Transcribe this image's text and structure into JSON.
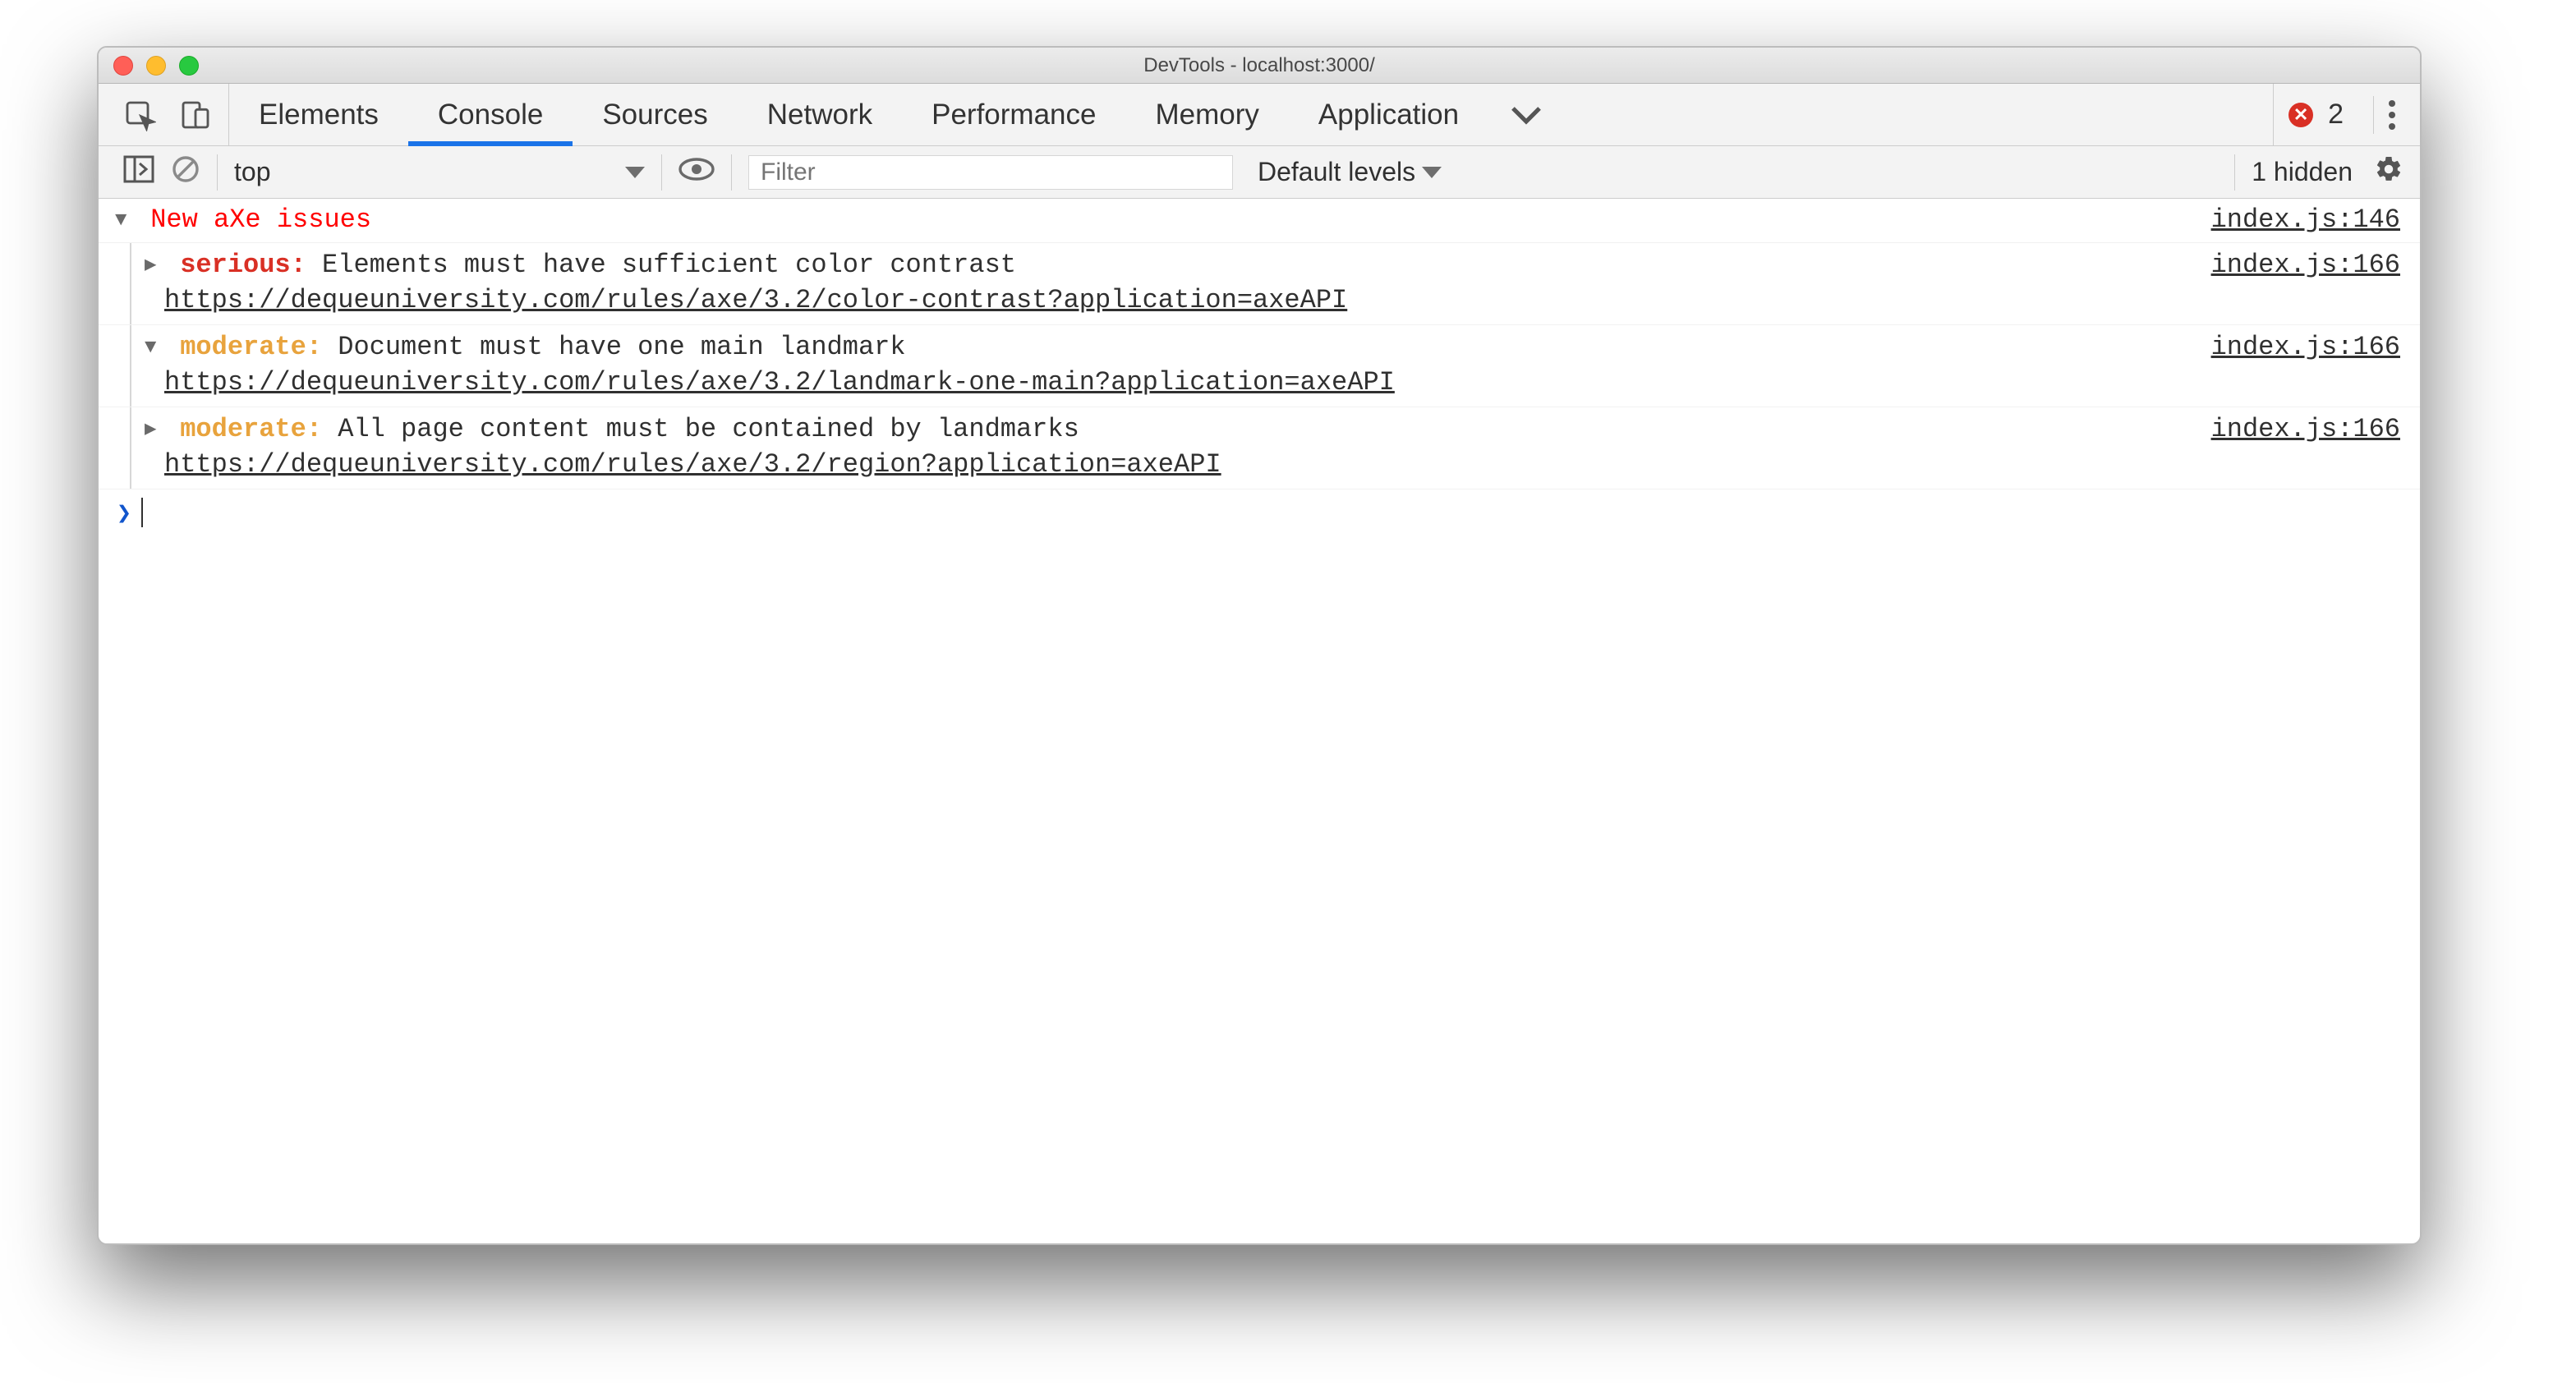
{
  "window": {
    "title": "DevTools - localhost:3000/"
  },
  "tabs": {
    "items": [
      "Elements",
      "Console",
      "Sources",
      "Network",
      "Performance",
      "Memory",
      "Application"
    ],
    "active_index": 1
  },
  "errors": {
    "count": "2"
  },
  "console_toolbar": {
    "context": "top",
    "filter_placeholder": "Filter",
    "levels": "Default levels",
    "hidden": "1 hidden"
  },
  "console": {
    "group": {
      "title": "New aXe issues",
      "source": "index.js:146"
    },
    "entries": [
      {
        "expanded": false,
        "severity": "serious",
        "severity_label": "serious:",
        "message": "Elements must have sufficient color contrast",
        "url": "https://dequeuniversity.com/rules/axe/3.2/color-contrast?application=axeAPI",
        "source": "index.js:166"
      },
      {
        "expanded": true,
        "severity": "moderate",
        "severity_label": "moderate:",
        "message": "Document must have one main landmark",
        "url": "https://dequeuniversity.com/rules/axe/3.2/landmark-one-main?application=axeAPI",
        "source": "index.js:166"
      },
      {
        "expanded": false,
        "severity": "moderate",
        "severity_label": "moderate:",
        "message": "All page content must be contained by landmarks",
        "url": "https://dequeuniversity.com/rules/axe/3.2/region?application=axeAPI",
        "source": "index.js:166"
      }
    ]
  }
}
